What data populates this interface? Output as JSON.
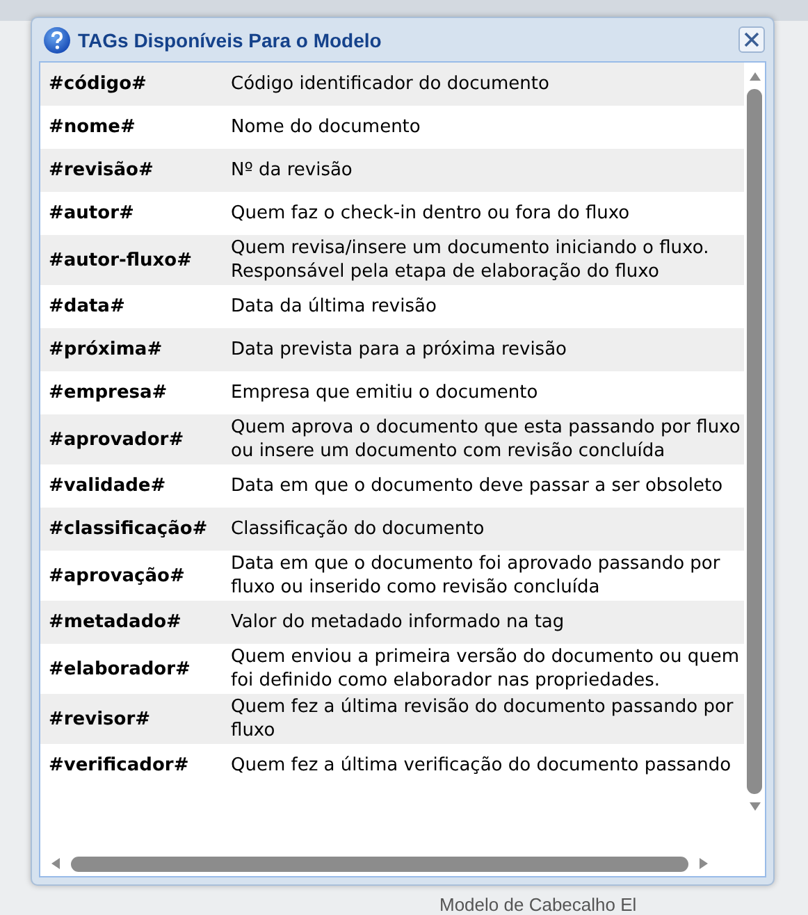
{
  "dialog": {
    "title": "TAGs Disponíveis Para o Modelo"
  },
  "tags": [
    {
      "tag": "#código#",
      "description": "Código identificador do documento"
    },
    {
      "tag": "#nome#",
      "description": "Nome do documento"
    },
    {
      "tag": "#revisão#",
      "description": "Nº da revisão"
    },
    {
      "tag": "#autor#",
      "description": "Quem faz o check-in dentro ou fora do fluxo"
    },
    {
      "tag": "#autor-fluxo#",
      "description": "Quem revisa/insere um documento iniciando o fluxo. Responsável pela etapa de elaboração do fluxo"
    },
    {
      "tag": "#data#",
      "description": "Data da última revisão"
    },
    {
      "tag": "#próxima#",
      "description": "Data prevista para a próxima revisão"
    },
    {
      "tag": "#empresa#",
      "description": "Empresa que emitiu o documento"
    },
    {
      "tag": "#aprovador#",
      "description": "Quem aprova o documento que esta passando por fluxo ou insere um documento com revisão concluída"
    },
    {
      "tag": "#validade#",
      "description": "Data em que o documento deve passar a ser obsoleto"
    },
    {
      "tag": "#classificação#",
      "description": "Classificação do documento"
    },
    {
      "tag": "#aprovação#",
      "description": "Data em que o documento foi aprovado passando por fluxo ou inserido como revisão concluída"
    },
    {
      "tag": "#metadado#",
      "description": "Valor do metadado informado na tag"
    },
    {
      "tag": "#elaborador#",
      "description": "Quem enviou a primeira versão do documento ou quem foi definido como elaborador nas propriedades."
    },
    {
      "tag": "#revisor#",
      "description": "Quem fez a última revisão do documento passando por fluxo"
    },
    {
      "tag": "#verificador#",
      "description": "Quem fez a última verificação do documento passando"
    }
  ],
  "background": {
    "label": "Modelo de Cabecalho El"
  }
}
